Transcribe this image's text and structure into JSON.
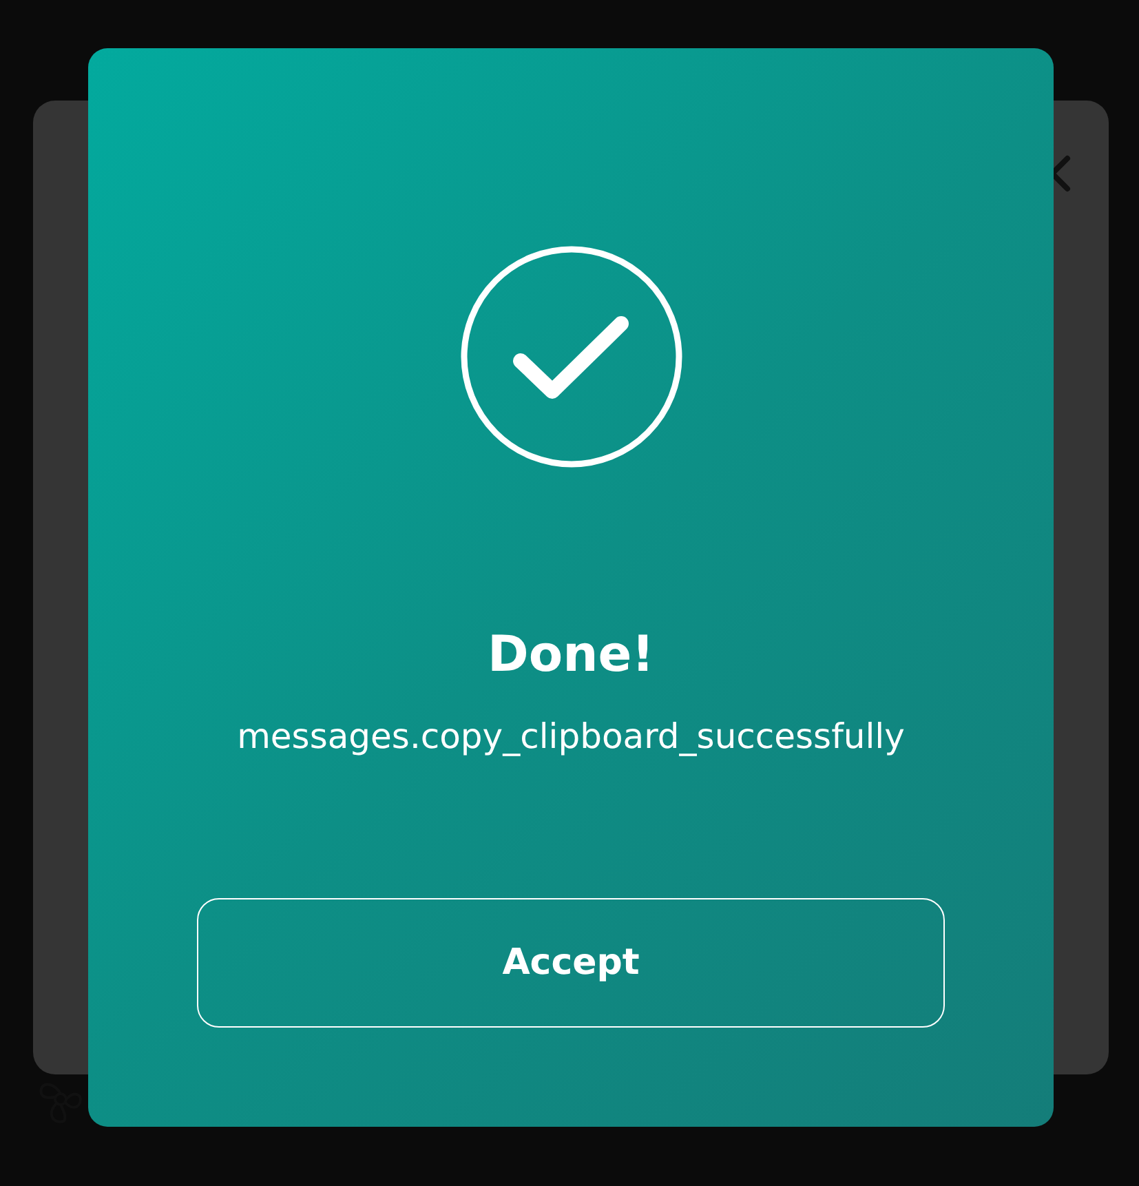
{
  "dialog": {
    "title": "Done!",
    "message": "messages.copy_clipboard_successfully",
    "button": "Accept"
  }
}
